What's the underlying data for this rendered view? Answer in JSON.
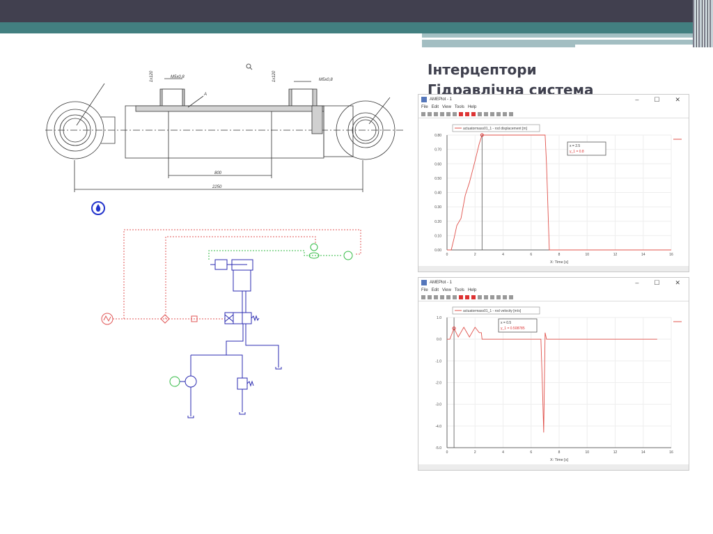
{
  "slide": {
    "title_line1": "Інтерцептори",
    "title_line2": "Гідравлічна система"
  },
  "drawing": {
    "dim_thread_left": "M5x0,8",
    "dim_thread_right": "M5x0,8",
    "dim_vert_left": "1x120",
    "dim_vert_right": "1x120",
    "detail_mark": "A",
    "dim_stroke": "800",
    "dim_total": "2250"
  },
  "windows": [
    {
      "title": "AMEPlot - 1",
      "menu": [
        "File",
        "Edit",
        "View",
        "Tools",
        "Help"
      ],
      "minimize": "–",
      "maximize": "☐",
      "close": "✕"
    },
    {
      "title": "AMEPlot - 1",
      "menu": [
        "File",
        "Edit",
        "View",
        "Tools",
        "Help"
      ],
      "minimize": "–",
      "maximize": "☐",
      "close": "✕"
    }
  ],
  "chart_data": [
    {
      "type": "line",
      "legend": "actuatormass01_1 - rod displacement [m]",
      "xlabel": "X: Time [s]",
      "ylabel": "",
      "xlim": [
        0,
        16
      ],
      "ylim": [
        0,
        0.8
      ],
      "xticks": [
        "0",
        "2",
        "4",
        "6",
        "8",
        "10",
        "12",
        "14",
        "16"
      ],
      "yticks": [
        "0.00",
        "0.10",
        "0.20",
        "0.30",
        "0.40",
        "0.50",
        "0.60",
        "0.70",
        "0.80"
      ],
      "cursor": {
        "x": 2.5,
        "label_x": "x   = 2.5",
        "label_y": "y_1 = 0.8"
      },
      "series": [
        {
          "name": "rod displacement",
          "color": "#e0504a",
          "x": [
            0,
            0.3,
            0.5,
            0.7,
            1.0,
            1.3,
            1.6,
            2.0,
            2.3,
            2.5,
            7.0,
            7.1,
            7.3,
            16
          ],
          "y": [
            0,
            0,
            0.08,
            0.17,
            0.22,
            0.38,
            0.47,
            0.62,
            0.74,
            0.8,
            0.8,
            0.6,
            0,
            0
          ]
        }
      ]
    },
    {
      "type": "line",
      "legend": "actuatormass01_1 - rod velocity [m/s]",
      "xlabel": "X: Time [s]",
      "ylabel": "",
      "xlim": [
        0,
        16
      ],
      "ylim": [
        -5,
        1
      ],
      "xticks": [
        "0",
        "2",
        "4",
        "6",
        "8",
        "10",
        "12",
        "14",
        "16"
      ],
      "yticks": [
        "-5.0",
        "-4.0",
        "-3.0",
        "-2.0",
        "-1.0",
        "0.0",
        "1.0"
      ],
      "cursor": {
        "x": 0.5,
        "label_x": "x   = 0.5",
        "label_y": "y_1 = 0.508785"
      },
      "series": [
        {
          "name": "rod velocity",
          "color": "#e0504a",
          "x": [
            0,
            0.2,
            0.5,
            0.8,
            1.2,
            1.6,
            2.0,
            2.3,
            2.45,
            2.5,
            6.7,
            6.8,
            6.9,
            7.0,
            7.1,
            15
          ],
          "y": [
            0,
            0,
            0.5,
            0.1,
            0.55,
            0.1,
            0.55,
            0.3,
            0.3,
            0,
            0,
            -2,
            -4.3,
            0.3,
            0,
            0
          ]
        }
      ]
    }
  ]
}
